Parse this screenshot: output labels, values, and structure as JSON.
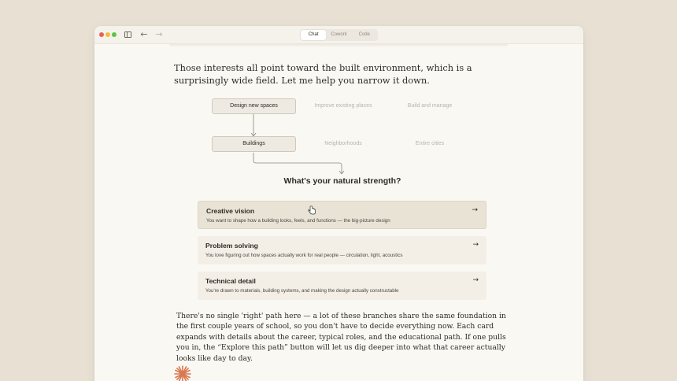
{
  "window": {
    "tabs": [
      {
        "label": "Chat",
        "active": true
      },
      {
        "label": "Cowork",
        "active": false
      },
      {
        "label": "Code",
        "active": false
      }
    ],
    "nav": {
      "back": "←",
      "forward": "→"
    }
  },
  "message": {
    "intro": "Those interests all point toward the built environment, which is a surprisingly wide field. Let me help you narrow it down.",
    "tree": {
      "row1": [
        "Design new spaces",
        "Improve existing places",
        "Build and manage"
      ],
      "row2": [
        "Buildings",
        "Neighborhoods",
        "Entire cities"
      ]
    },
    "question": "What's your natural strength?",
    "options": [
      {
        "title": "Creative vision",
        "description": "You want to shape how a building looks, feels, and functions — the big-picture design",
        "arrow": "→"
      },
      {
        "title": "Problem solving",
        "description": "You love figuring out how spaces actually work for real people — circulation, light, acoustics",
        "arrow": "→"
      },
      {
        "title": "Technical detail",
        "description": "You're drawn to materials, building systems, and making the design actually constructable",
        "arrow": "→"
      }
    ],
    "outro": "There's no single 'right' path here — a lot of these branches share the same foundation in the first couple years of school, so you don't have to decide everything now.  Each card expands with details about the career, typical roles, and the educational path. If one pulls you in, the “Explore this path” button will let us dig deeper into what that career actually looks like day to day."
  },
  "colors": {
    "background": "#e8e0d2",
    "window": "#faf8f3",
    "accent": "#d9774f"
  }
}
